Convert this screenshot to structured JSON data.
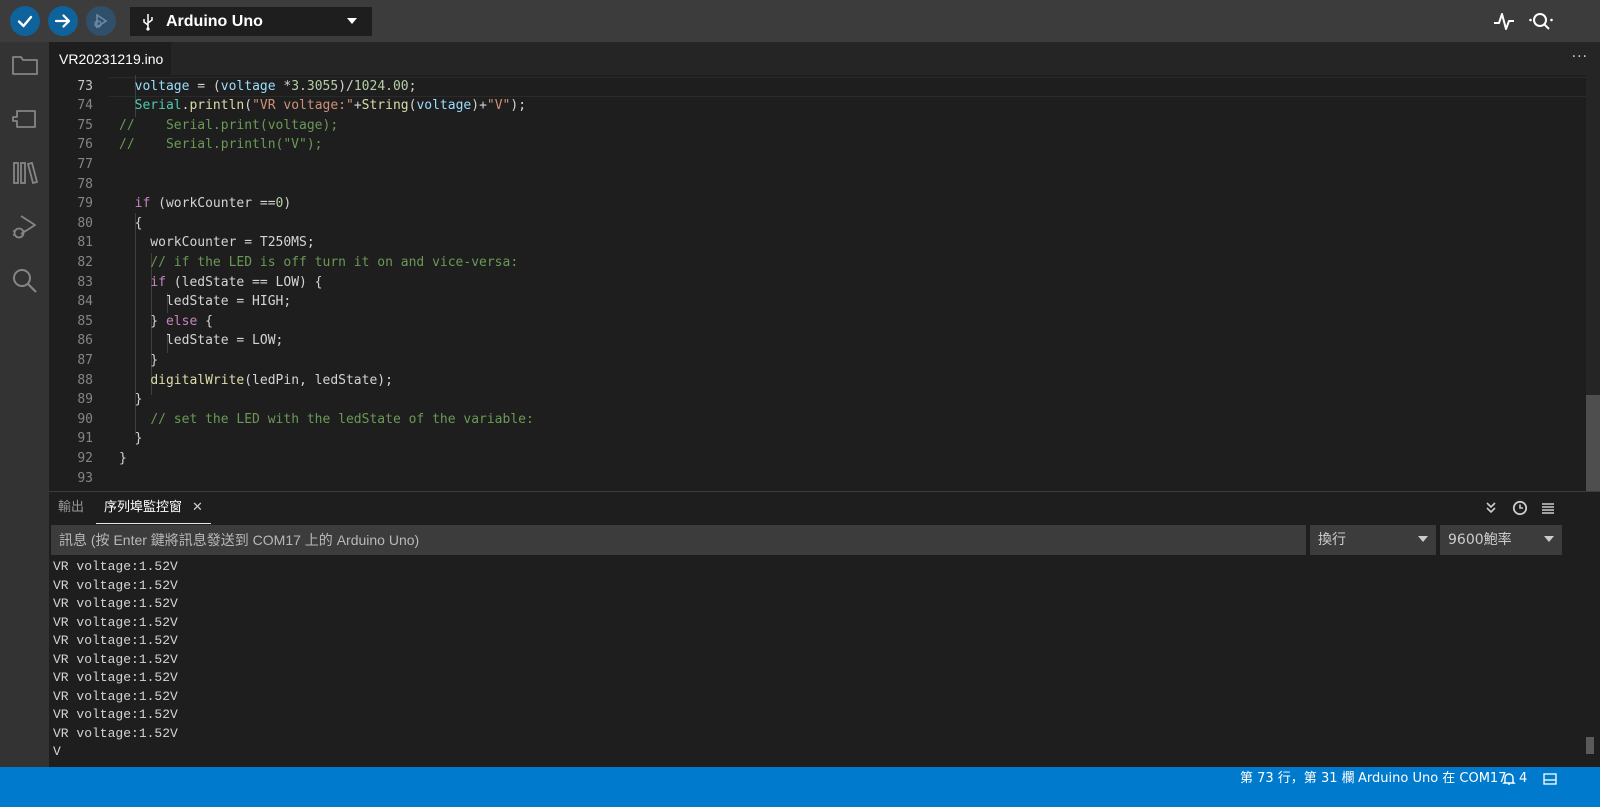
{
  "toolbar": {
    "verify_icon": "checkmark-icon",
    "upload_icon": "arrow-right-icon",
    "debug_icon": "debug-icon",
    "board_name": "Arduino Uno",
    "usb_icon": "usb-icon",
    "plotter_icon": "pulse-icon",
    "serial_monitor_icon": "magnifier-icon"
  },
  "activity_bar": [
    "folder-icon",
    "board-icon",
    "library-icon",
    "debug-icon",
    "search-icon"
  ],
  "editor": {
    "tab_label": "VR20231219.ino",
    "more_label": "···",
    "current_line": 73,
    "lines": [
      {
        "n": "",
        "html": "<span class=\"var\">voltage</span> = <span class=\"var\">voltage</span> * ..."
      },
      {
        "n": "73",
        "html": "  <span class=\"var\">voltage</span> = (<span class=\"var\">voltage</span> *<span class=\"num\">3.3055</span>)/<span class=\"num\">1024.00</span>;"
      },
      {
        "n": "74",
        "html": "  <span class=\"cls\">Serial</span>.<span class=\"fn\">println</span>(<span class=\"str\">\"VR voltage:\"</span>+<span class=\"fn\">String</span>(<span class=\"var\">voltage</span>)+<span class=\"str\">\"V\"</span>);"
      },
      {
        "n": "75",
        "html": "<span class=\"cmt\">//    Serial.print(voltage);</span>"
      },
      {
        "n": "76",
        "html": "<span class=\"cmt\">//    Serial.println(\"V\");</span>"
      },
      {
        "n": "77",
        "html": ""
      },
      {
        "n": "78",
        "html": ""
      },
      {
        "n": "79",
        "html": "  <span class=\"kw\">if</span> (workCounter ==<span class=\"num\">0</span>)"
      },
      {
        "n": "80",
        "html": "  {"
      },
      {
        "n": "81",
        "html": "    workCounter = T250MS;"
      },
      {
        "n": "82",
        "html": "    <span class=\"cmt\">// if the LED is off turn it on and vice-versa:</span>"
      },
      {
        "n": "83",
        "html": "    <span class=\"kw\">if</span> (ledState == LOW) {"
      },
      {
        "n": "84",
        "html": "      ledState = HIGH;"
      },
      {
        "n": "85",
        "html": "    } <span class=\"kw\">else</span> {"
      },
      {
        "n": "86",
        "html": "      ledState = LOW;"
      },
      {
        "n": "87",
        "html": "    }"
      },
      {
        "n": "88",
        "html": "    <span class=\"fn\">digitalWrite</span>(ledPin, ledState);"
      },
      {
        "n": "89",
        "html": "  }"
      },
      {
        "n": "90",
        "html": "    <span class=\"cmt\">// set the LED with the ledState of the variable:</span>"
      },
      {
        "n": "91",
        "html": "  }"
      },
      {
        "n": "92",
        "html": "}"
      },
      {
        "n": "93",
        "html": ""
      }
    ]
  },
  "panel": {
    "tab_output": "輸出",
    "tab_serial": "序列埠監控窗",
    "close_label": "✕",
    "message_placeholder": "訊息 (按 Enter 鍵將訊息發送到 COM17 上的 Arduino Uno)",
    "line_ending": "換行",
    "baud_rate": "9600鮑率",
    "icons": [
      "chevrons-down-icon",
      "clock-icon",
      "clear-output-icon"
    ],
    "output_lines": [
      "VR voltage:1.52V",
      "VR voltage:1.52V",
      "VR voltage:1.52V",
      "VR voltage:1.52V",
      "VR voltage:1.52V",
      "VR voltage:1.52V",
      "VR voltage:1.52V",
      "VR voltage:1.52V",
      "VR voltage:1.52V",
      "VR voltage:1.52V",
      "V"
    ]
  },
  "status": {
    "cursor_position": "第 73 行，第 31 欄",
    "board_port": "Arduino Uno 在 COM17",
    "notifications_count": "4",
    "bell_icon": "bell-icon",
    "layout_icon": "layout-icon"
  }
}
